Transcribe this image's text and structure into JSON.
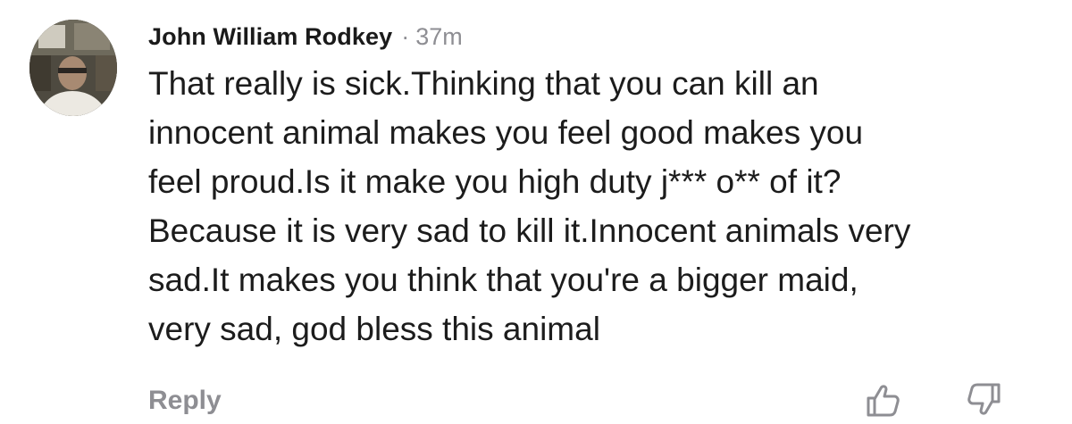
{
  "comment": {
    "author": "John William Rodkey",
    "separator": "·",
    "time": "37m",
    "text_lines": [
      "That really is sick.Thinking that you can kill an",
      "innocent animal makes you feel good makes you",
      "feel proud.Is it make you high duty j*** o** of it?",
      "Because it is very sad to kill it.Innocent animals very",
      "sad.It makes you think that you're a bigger maid,",
      "very sad, god bless this animal"
    ]
  },
  "actions": {
    "reply_label": "Reply",
    "like_icon": "thumbs-up-icon",
    "dislike_icon": "thumbs-down-icon"
  },
  "colors": {
    "text": "#1c1c1c",
    "secondary": "#8e8e93",
    "background": "#ffffff"
  }
}
